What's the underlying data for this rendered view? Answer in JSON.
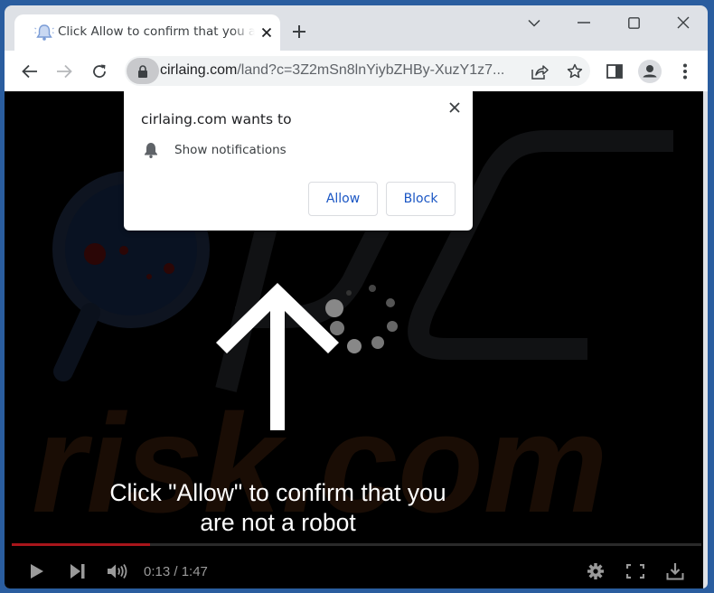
{
  "browser": {
    "tab": {
      "title": "Click Allow to confirm that you are not a robot",
      "favicon": "bell-favicon-icon"
    },
    "window_controls": {
      "tab_search": "chevron-down-icon",
      "minimize": "minimize-icon",
      "maximize": "maximize-icon",
      "close": "close-icon"
    },
    "toolbar": {
      "url_domain": "cirlaing.com",
      "url_path": "/land?c=3Z2mSn8lnYiybZHBy-XuzY1z7...",
      "icons": [
        "back-icon",
        "forward-icon",
        "reload-icon",
        "lock-icon",
        "share-icon",
        "star-icon",
        "side-panel-icon",
        "profile-icon",
        "menu-icon"
      ]
    }
  },
  "permission_popup": {
    "title": "cirlaing.com wants to",
    "permission": "Show notifications",
    "allow_label": "Allow",
    "block_label": "Block"
  },
  "video": {
    "caption_line1": "Click \"Allow\" to confirm that you",
    "caption_line2": "are not a robot",
    "current_time": "0:13",
    "duration": "1:47",
    "time_display": "0:13 / 1:47",
    "progress_fraction": 0.2,
    "watermark_text": "risk.com",
    "colors": {
      "progress_fill": "#a8151b",
      "accent_button_text": "#1a56c4"
    }
  }
}
